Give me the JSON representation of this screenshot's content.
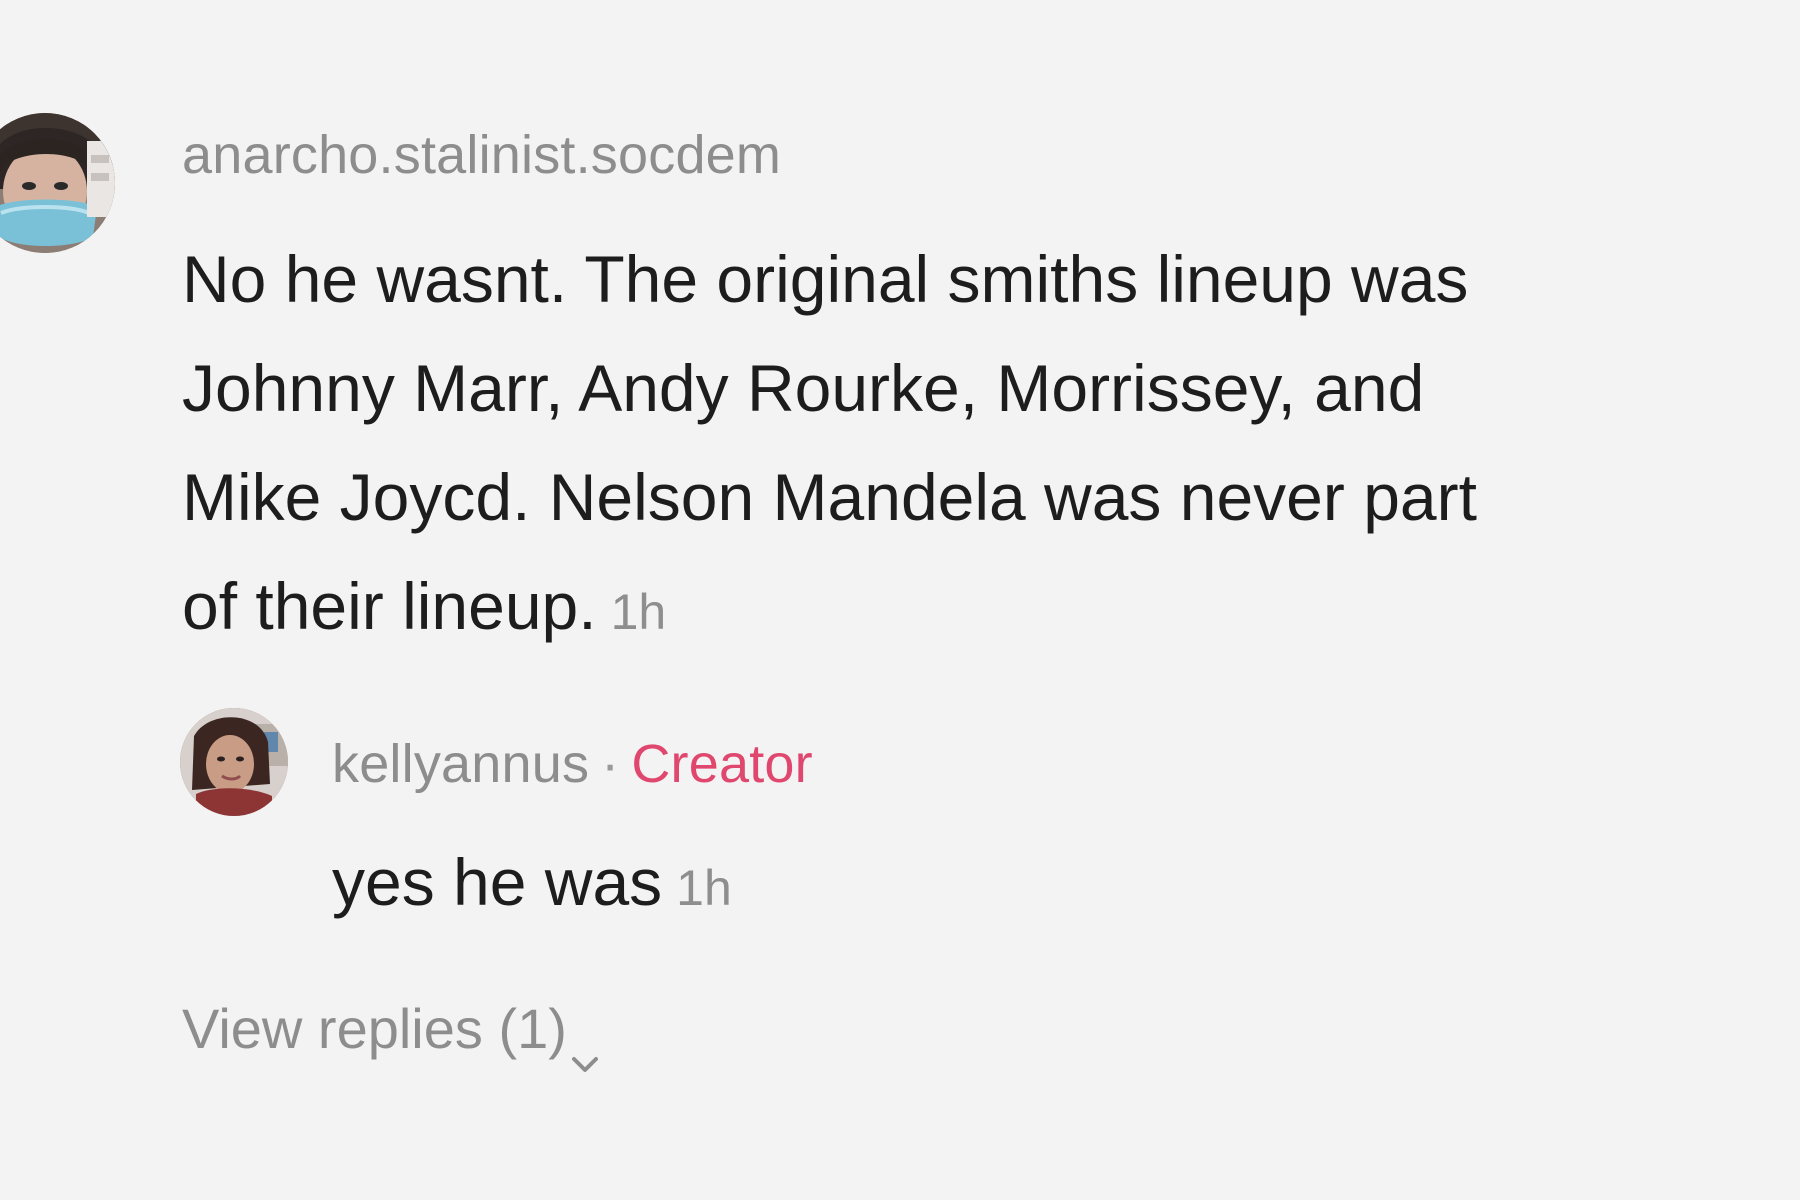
{
  "main_comment": {
    "username": "anarcho.stalinist.socdem",
    "text_lines": [
      "No he wasnt. The original smiths lineup was",
      "Johnny Marr, Andy Rourke, Morrissey, and",
      "Mike Joycd. Nelson Mandela was never part",
      "of their lineup."
    ],
    "timestamp": "1h"
  },
  "reply": {
    "username": "kellyannus",
    "separator": "·",
    "badge": "Creator",
    "text": "yes he was",
    "timestamp": "1h"
  },
  "view_replies": {
    "label": "View replies (1)"
  },
  "icons": {
    "main_avatar": "user-avatar-icon",
    "reply_avatar": "creator-avatar-icon",
    "chevron": "chevron-down-icon"
  },
  "colors": {
    "background": "#f3f3f3",
    "primary_text": "#1d1d1d",
    "secondary_text": "#8d8d8d",
    "creator_badge": "#e0476e"
  }
}
